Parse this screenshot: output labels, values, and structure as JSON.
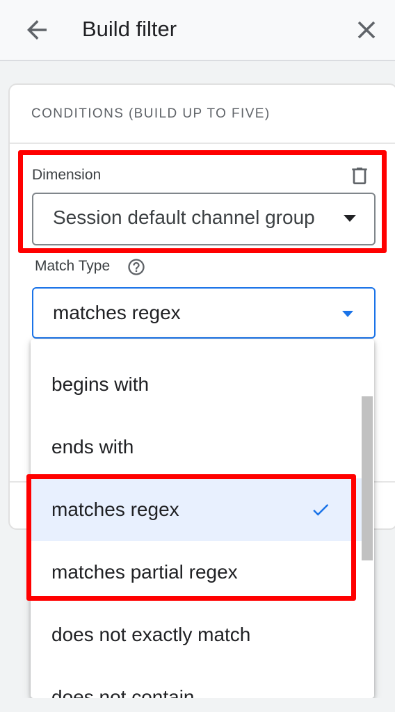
{
  "header": {
    "title": "Build filter",
    "back_icon": "arrow-left",
    "close_icon": "close-x"
  },
  "conditions": {
    "section_title": "CONDITIONS (BUILD UP TO FIVE)",
    "dimension": {
      "label": "Dimension",
      "value": "Session default channel group",
      "delete_icon": "trash"
    },
    "match_type": {
      "label": "Match Type",
      "help_icon": "question-circle",
      "value": "matches regex"
    }
  },
  "dropdown": {
    "options": [
      {
        "label": "begins with",
        "selected": false
      },
      {
        "label": "ends with",
        "selected": false
      },
      {
        "label": "matches regex",
        "selected": true
      },
      {
        "label": "matches partial regex",
        "selected": false
      },
      {
        "label": "does not exactly match",
        "selected": false
      },
      {
        "label": "does not contain",
        "selected": false
      }
    ],
    "check_icon": "checkmark"
  },
  "colors": {
    "accent": "#1a73e8",
    "selected_bg": "#e8f0fe",
    "highlight": "#ff0000"
  }
}
